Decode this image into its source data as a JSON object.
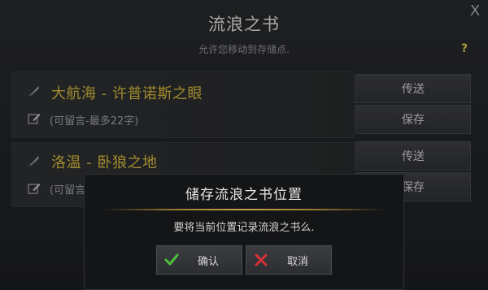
{
  "window": {
    "title": "流浪之书",
    "subtitle": "允许您移动到存储点.",
    "help": "?",
    "close": "X"
  },
  "entries": [
    {
      "name": "大航海 - 许普诺斯之眼",
      "note": "(可留言-最多22字)",
      "teleport_label": "传送",
      "save_label": "保存"
    },
    {
      "name": "洛温 - 卧狼之地",
      "note": "(可留言",
      "teleport_label": "传送",
      "save_label": "保存"
    }
  ],
  "dialog": {
    "title": "储存流浪之书位置",
    "message": "要将当前位置记录流浪之书么.",
    "confirm_label": "确认",
    "cancel_label": "取消"
  },
  "colors": {
    "accent_gold": "#cfb33c",
    "confirm_green": "#4cc23a",
    "cancel_red": "#d8323a"
  }
}
